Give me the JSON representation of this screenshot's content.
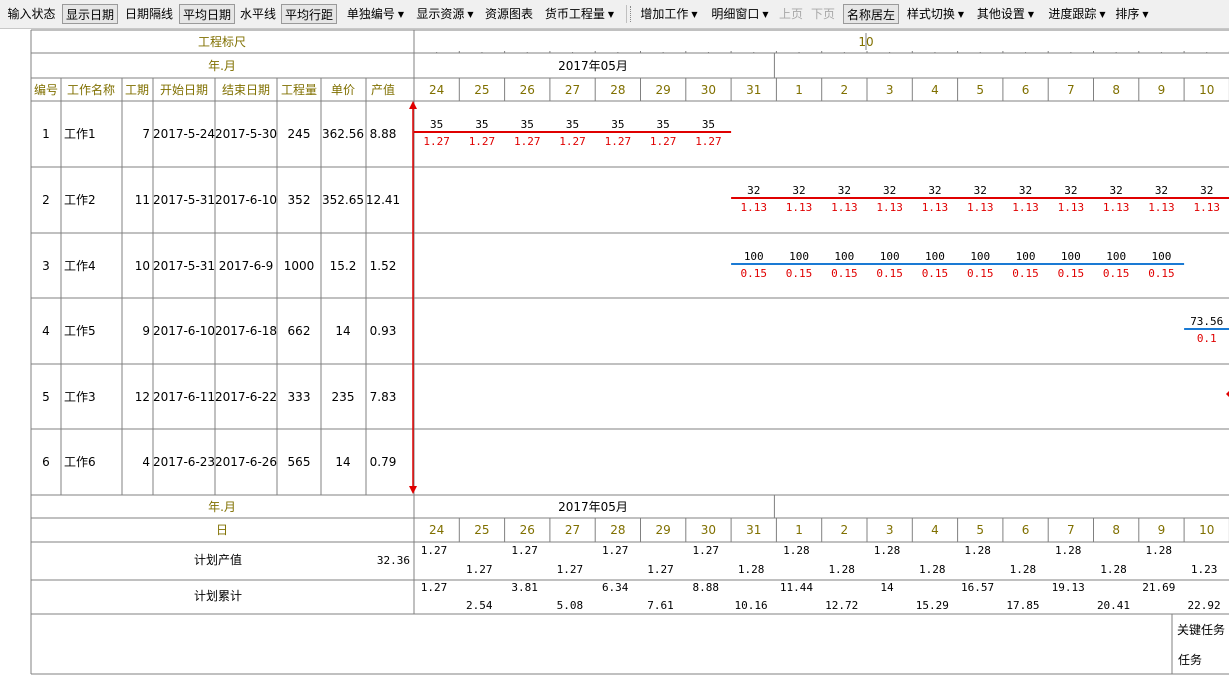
{
  "toolbar": {
    "items": [
      {
        "label": "输入状态",
        "pressed": false,
        "dropdown": false,
        "enabled": true
      },
      {
        "label": "显示日期",
        "pressed": true,
        "dropdown": false,
        "enabled": true
      },
      {
        "label": "日期隔线",
        "pressed": false,
        "dropdown": false,
        "enabled": true
      },
      {
        "label": "平均日期",
        "pressed": true,
        "dropdown": false,
        "enabled": true
      },
      {
        "label": "水平线",
        "pressed": false,
        "dropdown": false,
        "enabled": true
      },
      {
        "label": "平均行距",
        "pressed": true,
        "dropdown": false,
        "enabled": true
      },
      {
        "label": "单独编号",
        "pressed": false,
        "dropdown": true,
        "enabled": true
      },
      {
        "label": "显示资源",
        "pressed": false,
        "dropdown": true,
        "enabled": true
      },
      {
        "label": "资源图表",
        "pressed": false,
        "dropdown": false,
        "enabled": true
      },
      {
        "label": "货币工程量",
        "pressed": false,
        "dropdown": true,
        "enabled": true
      },
      {
        "label": "增加工作",
        "pressed": false,
        "dropdown": true,
        "enabled": true
      },
      {
        "label": "明细窗口",
        "pressed": false,
        "dropdown": true,
        "enabled": true
      },
      {
        "label": "上页",
        "pressed": false,
        "dropdown": false,
        "enabled": false
      },
      {
        "label": "下页",
        "pressed": false,
        "dropdown": false,
        "enabled": false
      },
      {
        "label": "名称居左",
        "pressed": true,
        "dropdown": false,
        "enabled": true
      },
      {
        "label": "样式切换",
        "pressed": false,
        "dropdown": true,
        "enabled": true
      },
      {
        "label": "其他设置",
        "pressed": false,
        "dropdown": true,
        "enabled": true
      },
      {
        "label": "进度跟踪",
        "pressed": false,
        "dropdown": true,
        "enabled": true
      },
      {
        "label": "排序",
        "pressed": false,
        "dropdown": true,
        "enabled": true
      }
    ],
    "dropdown_glyph": "▼"
  },
  "ruler": {
    "label": "工程标尺",
    "tick_label": "10"
  },
  "header": {
    "year_month_label": "年.月",
    "month": "2017年05月",
    "columns": [
      "编号",
      "工作名称",
      "工期",
      "开始日期",
      "结束日期",
      "工程量",
      "单价",
      "产值"
    ],
    "days": [
      "24",
      "25",
      "26",
      "27",
      "28",
      "29",
      "30",
      "31",
      "1",
      "2",
      "3",
      "4",
      "5",
      "6",
      "7",
      "8",
      "9",
      "10"
    ]
  },
  "tasks": [
    {
      "id": "1",
      "name": "工作1",
      "duration": "7",
      "start": "2017-5-24",
      "end": "2017-5-30",
      "qty": "245",
      "price": "362.56",
      "value": "8.88",
      "bar": {
        "color": "#e00000",
        "start_day_index": 0,
        "end_day_index": 7,
        "qty_label": "35",
        "value_label": "1.27",
        "label_count": 7
      }
    },
    {
      "id": "2",
      "name": "工作2",
      "duration": "11",
      "start": "2017-5-31",
      "end": "2017-6-10",
      "qty": "352",
      "price": "352.65",
      "value": "12.41",
      "bar": {
        "color": "#e00000",
        "start_day_index": 7,
        "end_day_index": 18,
        "qty_label": "32",
        "value_label": "1.13",
        "label_count": 11
      }
    },
    {
      "id": "3",
      "name": "工作4",
      "duration": "10",
      "start": "2017-5-31",
      "end": "2017-6-9",
      "qty": "1000",
      "price": "15.2",
      "value": "1.52",
      "bar": {
        "color": "#1a7ad4",
        "start_day_index": 7,
        "end_day_index": 17,
        "qty_label": "100",
        "value_label": "0.15",
        "label_count": 10
      }
    },
    {
      "id": "4",
      "name": "工作5",
      "duration": "9",
      "start": "2017-6-10",
      "end": "2017-6-18",
      "qty": "662",
      "price": "14",
      "value": "0.93",
      "bar": {
        "color": "#1a7ad4",
        "start_day_index": 17,
        "end_day_index": 18,
        "qty_label": "73.56",
        "value_label": "0.1",
        "label_count": 1
      }
    },
    {
      "id": "5",
      "name": "工作3",
      "duration": "12",
      "start": "2017-6-11",
      "end": "2017-6-22",
      "qty": "333",
      "price": "235",
      "value": "7.83"
    },
    {
      "id": "6",
      "name": "工作6",
      "duration": "4",
      "start": "2017-6-23",
      "end": "2017-6-26",
      "qty": "565",
      "price": "14",
      "value": "0.79"
    }
  ],
  "footer": {
    "day_label": "日",
    "plan_value_label": "计划产值",
    "plan_value_total": "32.36",
    "plan_value_top": [
      "1.27",
      "",
      "1.27",
      "",
      "1.27",
      "",
      "1.27",
      "",
      "1.28",
      "",
      "1.28",
      "",
      "1.28",
      "",
      "1.28",
      "",
      "1.28",
      ""
    ],
    "plan_value_bottom": [
      "",
      "1.27",
      "",
      "1.27",
      "",
      "1.27",
      "",
      "1.28",
      "",
      "1.28",
      "",
      "1.28",
      "",
      "1.28",
      "",
      "1.28",
      "",
      "1.23"
    ],
    "cumulative_label": "计划累计",
    "cumulative_top": [
      "1.27",
      "",
      "3.81",
      "",
      "6.34",
      "",
      "8.88",
      "",
      "11.44",
      "",
      "14",
      "",
      "16.57",
      "",
      "19.13",
      "",
      "21.69",
      ""
    ],
    "cumulative_bottom": [
      "",
      "2.54",
      "",
      "5.08",
      "",
      "7.61",
      "",
      "10.16",
      "",
      "12.72",
      "",
      "15.29",
      "",
      "17.85",
      "",
      "20.41",
      "",
      "22.92"
    ]
  },
  "legend": {
    "critical_task": "关键任务",
    "task": "任务"
  },
  "colors": {
    "header_text": "#807000",
    "critical": "#e00000",
    "normal": "#1a7ad4",
    "grid": "#808080"
  }
}
